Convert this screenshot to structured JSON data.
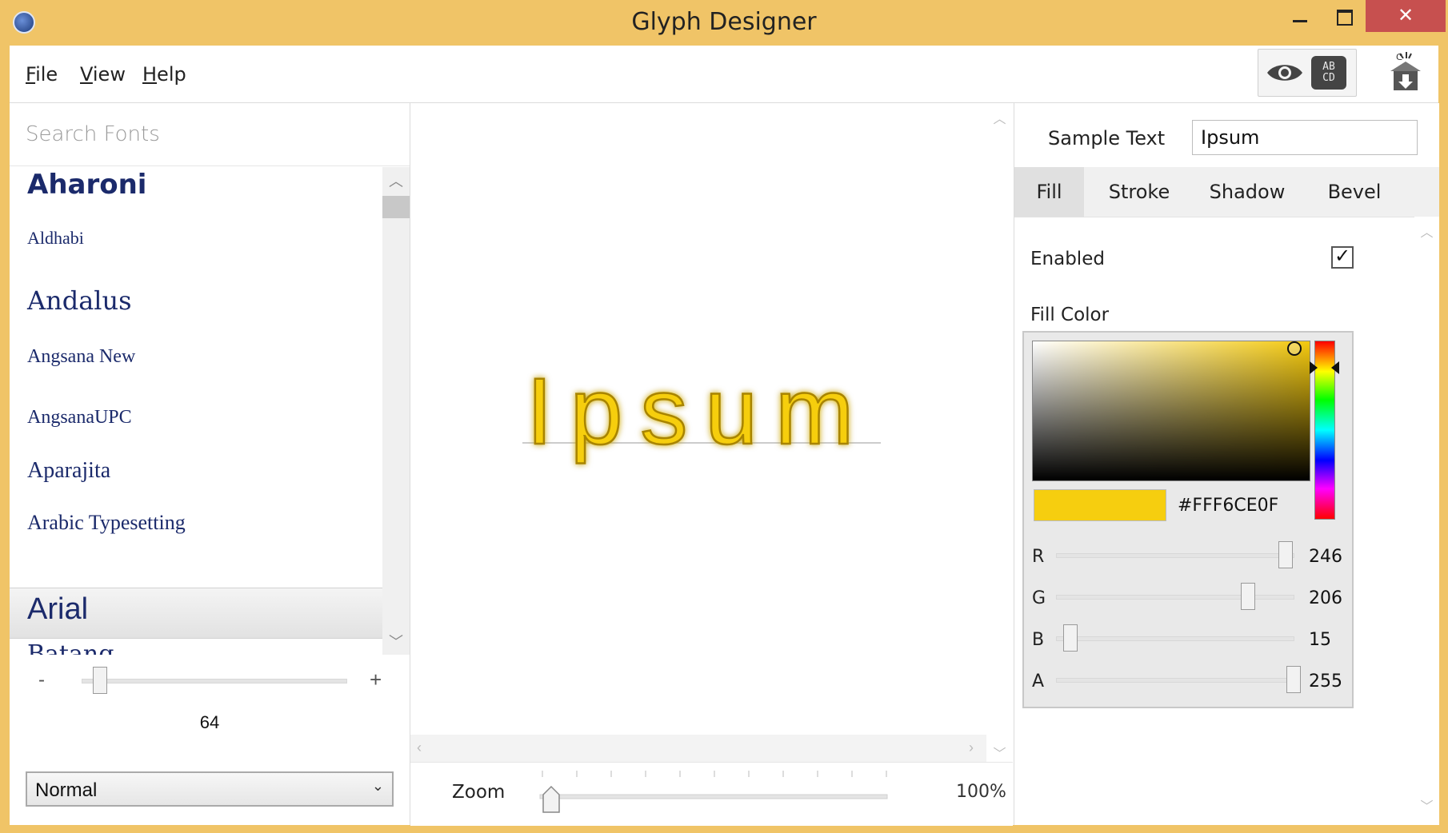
{
  "window": {
    "title": "Glyph Designer",
    "controls": {
      "minimize": "—",
      "maximize": "☐",
      "close": "✕"
    }
  },
  "menu": {
    "items": [
      {
        "label": "File",
        "accel": "F"
      },
      {
        "label": "View",
        "accel": "V"
      },
      {
        "label": "Help",
        "accel": "H"
      }
    ]
  },
  "toolbar": {
    "preview_icon": "eye-icon",
    "glyph_icon_text": {
      "line1": "AB",
      "line2": "CD"
    },
    "export_icon": "export-icon"
  },
  "fonts": {
    "search_placeholder": "Search Fonts",
    "items": [
      {
        "name": "Aharoni"
      },
      {
        "name": "Aldhabi"
      },
      {
        "name": "Andalus"
      },
      {
        "name": "Angsana New"
      },
      {
        "name": "AngsanaUPC"
      },
      {
        "name": "Aparajita"
      },
      {
        "name": "Arabic Typesetting"
      },
      {
        "name": "Arial",
        "selected": true
      },
      {
        "name": "Batang"
      }
    ]
  },
  "size": {
    "minus": "-",
    "plus": "+",
    "value": "64"
  },
  "style_select": {
    "value": "Normal"
  },
  "preview": {
    "text": "Ipsum",
    "fill_color": "#F6CE0F"
  },
  "zoom": {
    "label": "Zoom",
    "value": "100%"
  },
  "right": {
    "sample_text_label": "Sample Text",
    "sample_text_value": "Ipsum",
    "tabs": [
      {
        "label": "Fill",
        "active": true
      },
      {
        "label": "Stroke"
      },
      {
        "label": "Shadow"
      },
      {
        "label": "Bevel"
      }
    ],
    "enabled_label": "Enabled",
    "enabled_checked": true,
    "check_glyph": "✓",
    "fill_color_label": "Fill Color",
    "hex": "#FFF6CE0F",
    "swatch_color": "#F6CE0F",
    "channels": [
      {
        "label": "R",
        "value": "246"
      },
      {
        "label": "G",
        "value": "206"
      },
      {
        "label": "B",
        "value": "15"
      },
      {
        "label": "A",
        "value": "255"
      }
    ]
  }
}
